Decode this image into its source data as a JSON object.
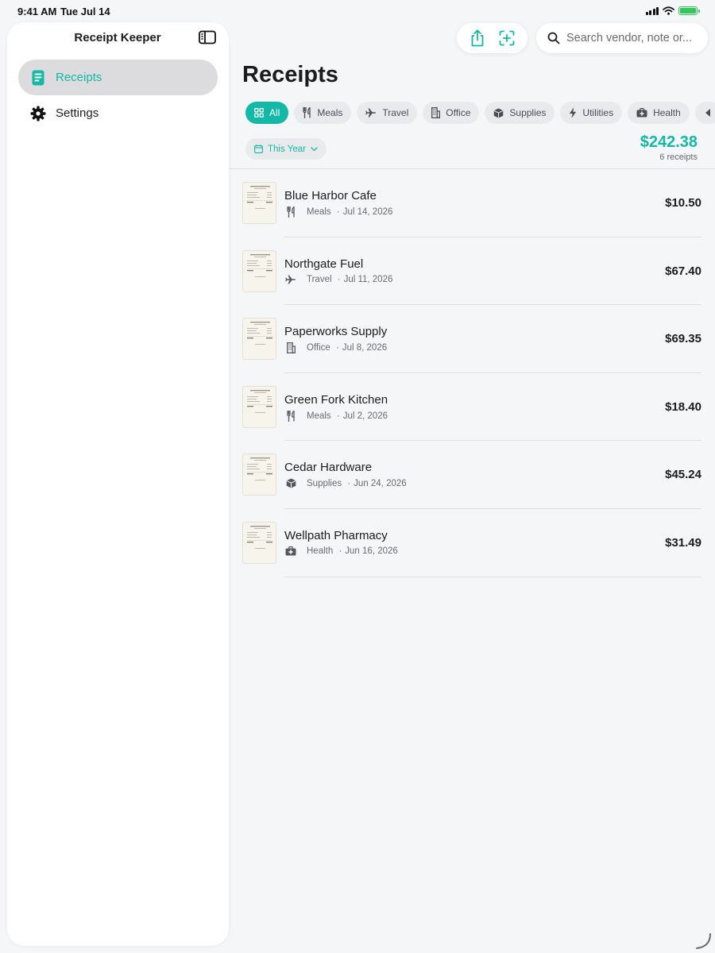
{
  "status_bar": {
    "time": "9:41 AM",
    "date": "Tue Jul 14"
  },
  "sidebar": {
    "title": "Receipt Keeper",
    "items": [
      {
        "label": "Receipts",
        "icon": "receipt-icon",
        "active": true
      },
      {
        "label": "Settings",
        "icon": "gear-icon",
        "active": false
      }
    ]
  },
  "toolbar": {
    "share_icon": "share-icon",
    "scan_icon": "scan-add-icon"
  },
  "search": {
    "placeholder": "Search vendor, note or..."
  },
  "page": {
    "title": "Receipts"
  },
  "categories": [
    {
      "label": "All",
      "icon": "grid-icon",
      "active": true
    },
    {
      "label": "Meals",
      "icon": "utensils-icon"
    },
    {
      "label": "Travel",
      "icon": "airplane-icon"
    },
    {
      "label": "Office",
      "icon": "building-icon"
    },
    {
      "label": "Supplies",
      "icon": "box-icon"
    },
    {
      "label": "Utilities",
      "icon": "bolt-icon"
    },
    {
      "label": "Health",
      "icon": "medkit-icon"
    }
  ],
  "filter": {
    "label": "This Year"
  },
  "summary": {
    "total": "$242.38",
    "count": "6 receipts"
  },
  "receipts": [
    {
      "vendor": "Blue Harbor Cafe",
      "category": "Meals",
      "icon": "utensils-icon",
      "date": "Jul 14, 2026",
      "amount": "$10.50"
    },
    {
      "vendor": "Northgate Fuel",
      "category": "Travel",
      "icon": "airplane-icon",
      "date": "Jul 11, 2026",
      "amount": "$67.40"
    },
    {
      "vendor": "Paperworks Supply",
      "category": "Office",
      "icon": "building-icon",
      "date": "Jul 8, 2026",
      "amount": "$69.35"
    },
    {
      "vendor": "Green Fork Kitchen",
      "category": "Meals",
      "icon": "utensils-icon",
      "date": "Jul 2, 2026",
      "amount": "$18.40"
    },
    {
      "vendor": "Cedar Hardware",
      "category": "Supplies",
      "icon": "box-icon",
      "date": "Jun 24, 2026",
      "amount": "$45.24"
    },
    {
      "vendor": "Wellpath Pharmacy",
      "category": "Health",
      "icon": "medkit-icon",
      "date": "Jun 16, 2026",
      "amount": "$31.49"
    }
  ],
  "colors": {
    "accent": "#14b8a6",
    "background": "#f5f6f8",
    "chip": "#e9eaec"
  }
}
